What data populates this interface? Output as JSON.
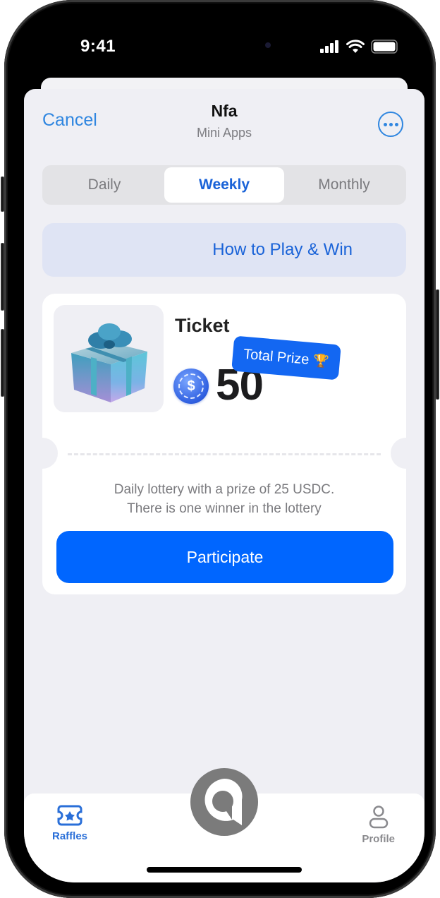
{
  "status_bar": {
    "time": "9:41",
    "icons": [
      "signal-icon",
      "wifi-icon",
      "battery-icon"
    ]
  },
  "nav": {
    "cancel_label": "Cancel",
    "title": "Nfa",
    "subtitle": "Mini Apps",
    "more_icon": "ellipsis-circle-icon"
  },
  "segments": {
    "items": [
      {
        "label": "Daily",
        "active": false
      },
      {
        "label": "Weekly",
        "active": true
      },
      {
        "label": "Monthly",
        "active": false
      }
    ]
  },
  "how_to": {
    "label": "How to Play & Win"
  },
  "ticket_card": {
    "image_icon": "gift-box-icon",
    "title": "Ticket",
    "currency_icon": "usdc-coin-icon",
    "currency_symbol": "$",
    "amount": "50",
    "badge_label": "Total Prize",
    "badge_icon": "🏆",
    "description_line1": "Daily lottery with a prize of 25 USDC.",
    "description_line2": "There is one winner in the lottery",
    "participate_label": "Participate"
  },
  "tab_bar": {
    "items": [
      {
        "label": "Raffles",
        "icon": "ticket-icon",
        "active": true
      },
      {
        "label": "Profile",
        "icon": "person-icon",
        "active": false
      }
    ],
    "center_icon": "app-logo-icon"
  },
  "colors": {
    "accent": "#2f86e0",
    "primary_button": "#0066ff",
    "badge": "#1367f2",
    "sheet_bg": "#efeff4"
  }
}
